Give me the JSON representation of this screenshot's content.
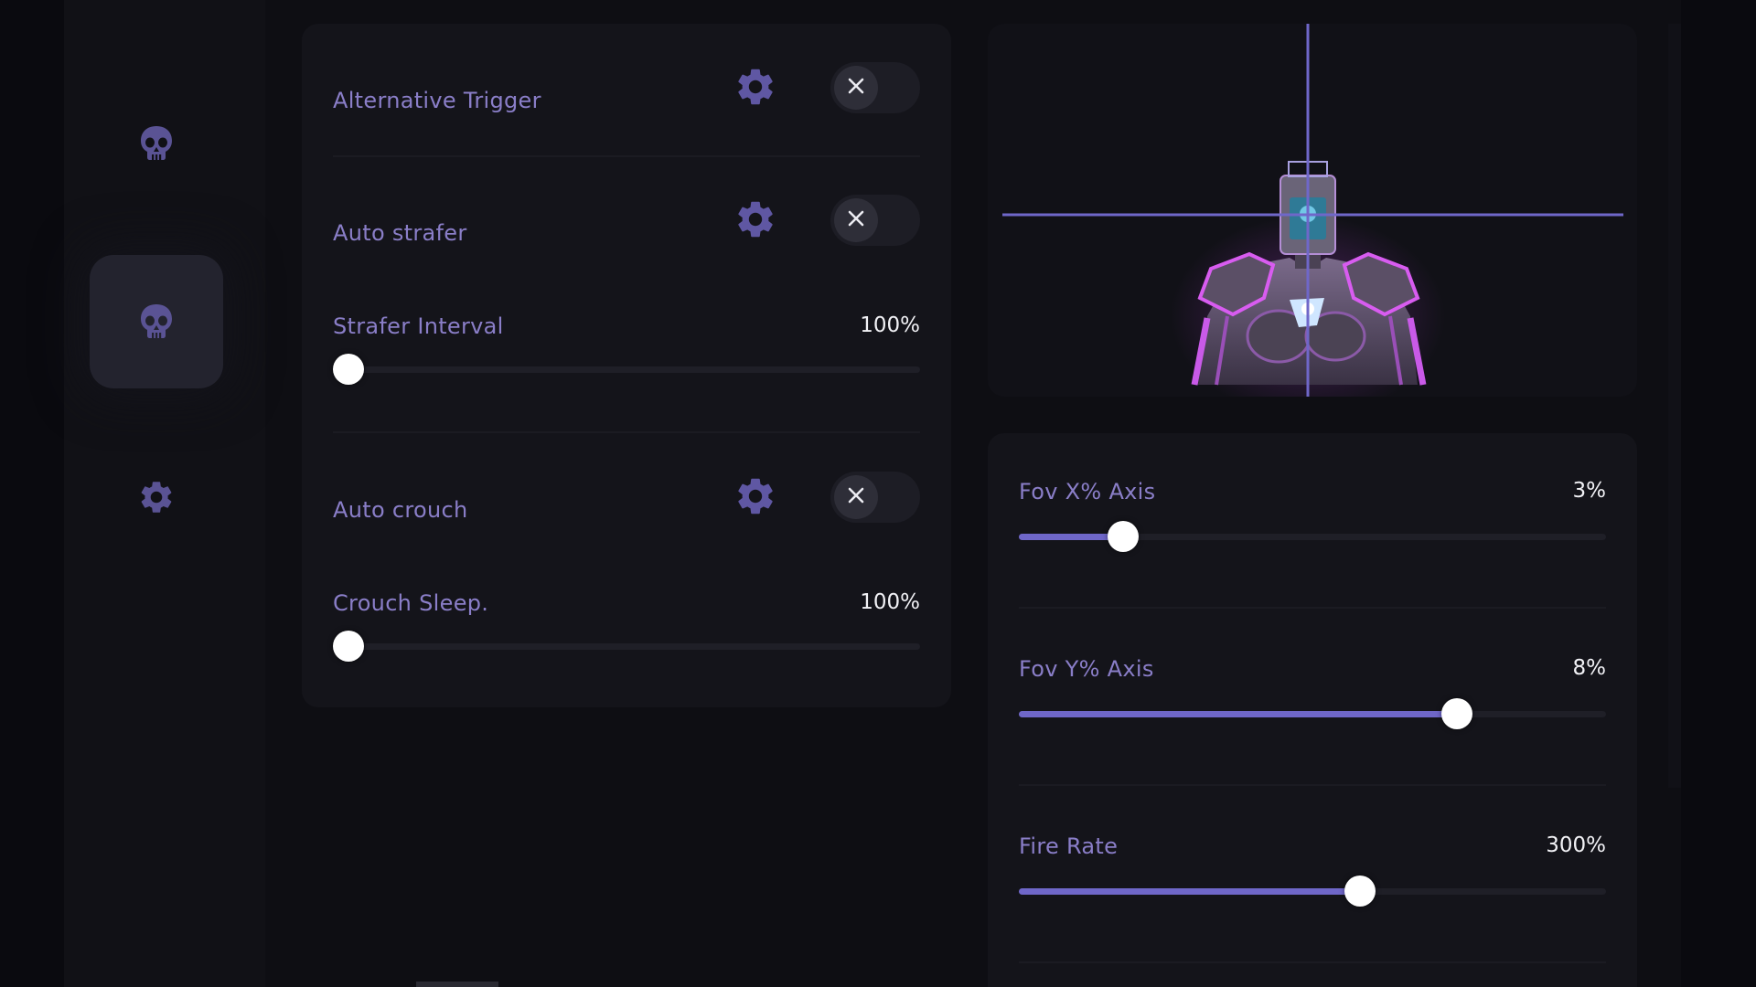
{
  "window": {
    "accent": "#6f67c9",
    "label_color": "#8a7ec8"
  },
  "sidebar": {
    "items": [
      {
        "icon": "skull-icon",
        "active": false
      },
      {
        "icon": "skull-icon",
        "active": true
      },
      {
        "icon": "gear-icon",
        "active": false
      }
    ]
  },
  "features": {
    "alternative_trigger": {
      "label": "Alternative Trigger",
      "enabled": false
    },
    "auto_strafer": {
      "label": "Auto strafer",
      "enabled": false
    },
    "strafer_interval": {
      "label": "Strafer Interval",
      "value_text": "100%",
      "fraction": 0.0
    },
    "auto_crouch": {
      "label": "Auto crouch",
      "enabled": false
    },
    "crouch_sleep": {
      "label": "Crouch Sleep.",
      "value_text": "100%",
      "fraction": 0.0
    }
  },
  "preview": {
    "icon": "robot-target-preview"
  },
  "aim": {
    "fov_x": {
      "label": "Fov X% Axis",
      "value_text": "3%",
      "fraction": 0.16
    },
    "fov_y": {
      "label": "Fov Y% Axis",
      "value_text": "8%",
      "fraction": 0.76
    },
    "fire_rate": {
      "label": "Fire Rate",
      "value_text": "300%",
      "fraction": 0.585
    }
  }
}
